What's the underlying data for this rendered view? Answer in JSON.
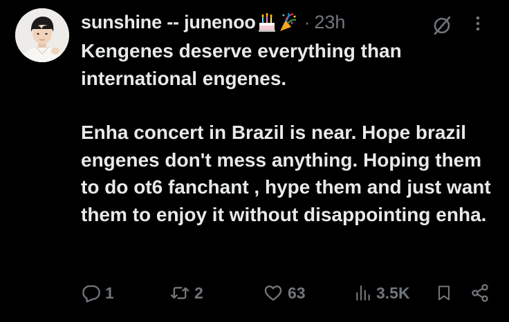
{
  "tweet": {
    "display_name": "sunshine -- junenoo",
    "name_emojis": [
      "birthday-cake-emoji",
      "party-popper-emoji"
    ],
    "separator": "·",
    "time": "23h",
    "text_paragraph_1": "Kengenes deserve everything than international engenes.",
    "text_paragraph_2": "Enha concert in Brazil is near. Hope brazil engenes don't mess anything. Hoping them to do ot6 fanchant , hype them and just want them to enjoy it without disappointing enha."
  },
  "actions": {
    "replies": "1",
    "reposts": "2",
    "likes": "63",
    "views": "3.5K"
  },
  "icons": {
    "reply": "reply-icon",
    "repost": "repost-icon",
    "like": "heart-icon",
    "views": "analytics-icon",
    "bookmark": "bookmark-icon",
    "share": "share-icon",
    "grok": "grok-icon",
    "more": "more-icon"
  },
  "colors": {
    "background": "#000000",
    "text": "#e7e9ea",
    "muted": "#71767b"
  }
}
